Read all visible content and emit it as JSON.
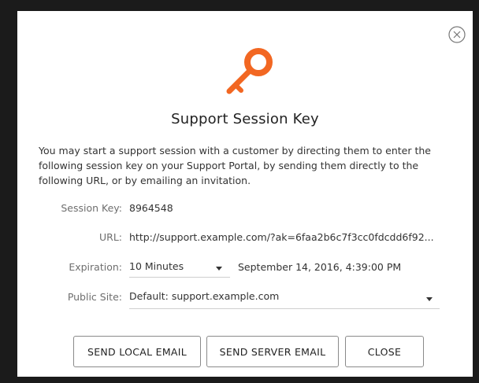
{
  "dialog": {
    "title": "Support Session Key",
    "description": "You may start a support session with a customer by directing them to enter the following session key on your Support Portal, by sending them directly to the following URL, or by emailing an invitation.",
    "accent_color": "#f26722",
    "close_icon": "close-circle-icon",
    "key_icon": "key-icon"
  },
  "fields": {
    "session_key": {
      "label": "Session Key:",
      "value": "8964548"
    },
    "url": {
      "label": "URL:",
      "value": "http://support.example.com/?ak=6faa2b6c7f3cc0fdcdd6f92..."
    },
    "expiration": {
      "label": "Expiration:",
      "selected": "10 Minutes",
      "expires_at": "September 14, 2016, 4:39:00 PM"
    },
    "public_site": {
      "label": "Public Site:",
      "selected": "Default: support.example.com"
    }
  },
  "buttons": {
    "send_local_email": "SEND LOCAL EMAIL",
    "send_server_email": "SEND SERVER EMAIL",
    "close": "CLOSE"
  }
}
